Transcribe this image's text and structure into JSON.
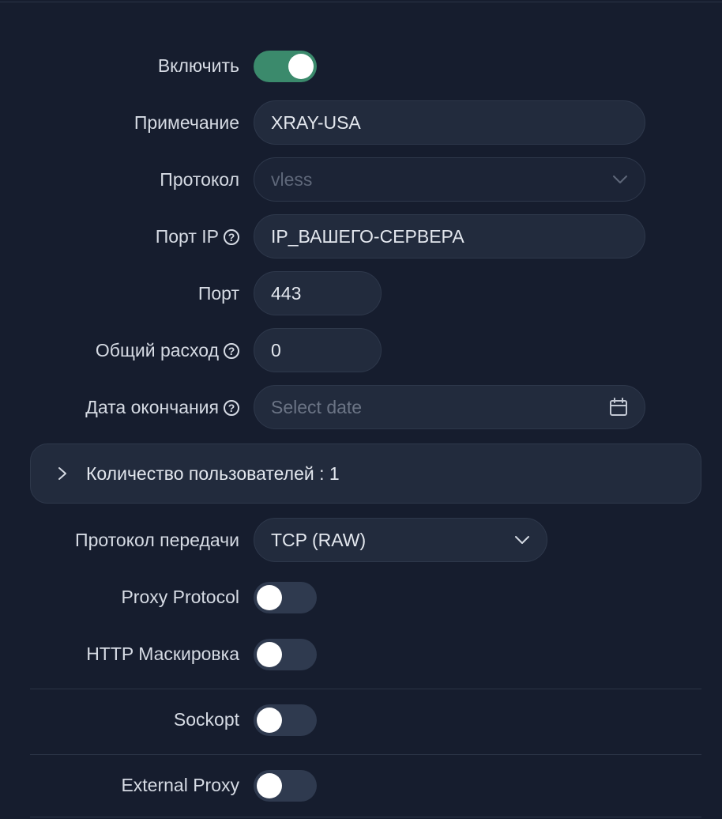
{
  "form": {
    "enable": {
      "label": "Включить",
      "on": true
    },
    "remark": {
      "label": "Примечание",
      "value": "XRAY-USA"
    },
    "protocol": {
      "label": "Протокол",
      "value": "vless"
    },
    "listen_ip": {
      "label": "Порт IP",
      "value": "IP_ВАШЕГО-СЕРВЕРА"
    },
    "port": {
      "label": "Порт",
      "value": "443"
    },
    "total_traffic": {
      "label": "Общий расход",
      "value": "0"
    },
    "expiry": {
      "label": "Дата окончания",
      "placeholder": "Select date"
    },
    "clients": {
      "label": "Количество пользователей : 1"
    },
    "transmission": {
      "label": "Протокол передачи",
      "value": "TCP (RAW)"
    },
    "proxy_protocol": {
      "label": "Proxy Protocol",
      "on": false
    },
    "http_obfuscation": {
      "label": "HTTP Маскировка",
      "on": false
    },
    "sockopt": {
      "label": "Sockopt",
      "on": false
    },
    "external_proxy": {
      "label": "External Proxy",
      "on": false
    }
  },
  "colors": {
    "background": "#161d2e",
    "field": "#222b3d",
    "toggle_on": "#3b8a6c",
    "toggle_off": "#2f3a4f"
  },
  "icons": {
    "help": "question-circle-icon",
    "dropdown": "chevron-down-icon",
    "calendar": "calendar-icon",
    "expand": "chevron-right-icon"
  }
}
